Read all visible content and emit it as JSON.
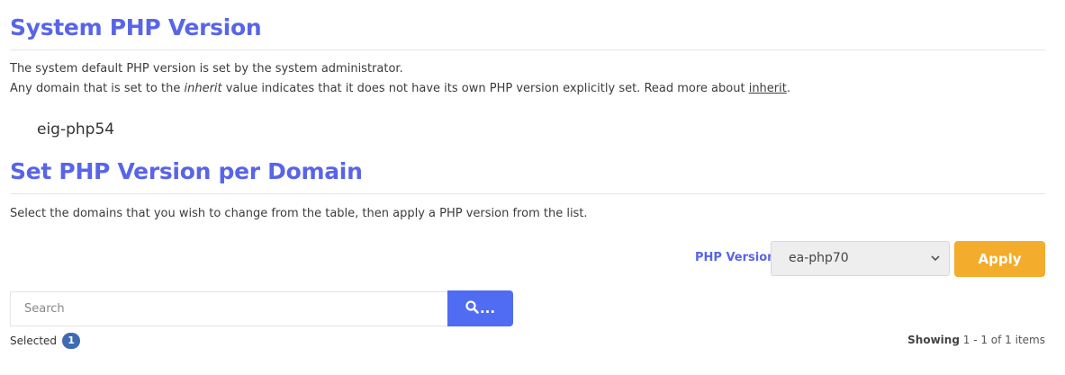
{
  "system_section": {
    "title": "System PHP Version",
    "line1": "The system default PHP version is set by the system administrator.",
    "line2_before": "Any domain that is set to the ",
    "line2_em": "inherit",
    "line2_middle": " value indicates that it does not have its own PHP version explicitly set. Read more about ",
    "line2_link": "inherit",
    "line2_after": ".",
    "version": "eig-php54"
  },
  "domain_section": {
    "title": "Set PHP Version per Domain",
    "description": "Select the domains that you wish to change from the table, then apply a PHP version from the list."
  },
  "php_version": {
    "label": "PHP Version",
    "selected": "ea-php70"
  },
  "apply_label": "Apply",
  "search": {
    "placeholder": "Search",
    "button_text": "..."
  },
  "selected": {
    "label": "Selected",
    "count": "1"
  },
  "pagination": {
    "showing_label": "Showing",
    "range": "1 - 1 of 1 items"
  },
  "colors": {
    "heading": "#5865e8",
    "apply": "#f4ac2c",
    "search_button": "#4f6cf2",
    "badge": "#3d6cb4"
  },
  "icons": {
    "search": "search-icon",
    "select_arrow": "chevron-down-icon"
  }
}
